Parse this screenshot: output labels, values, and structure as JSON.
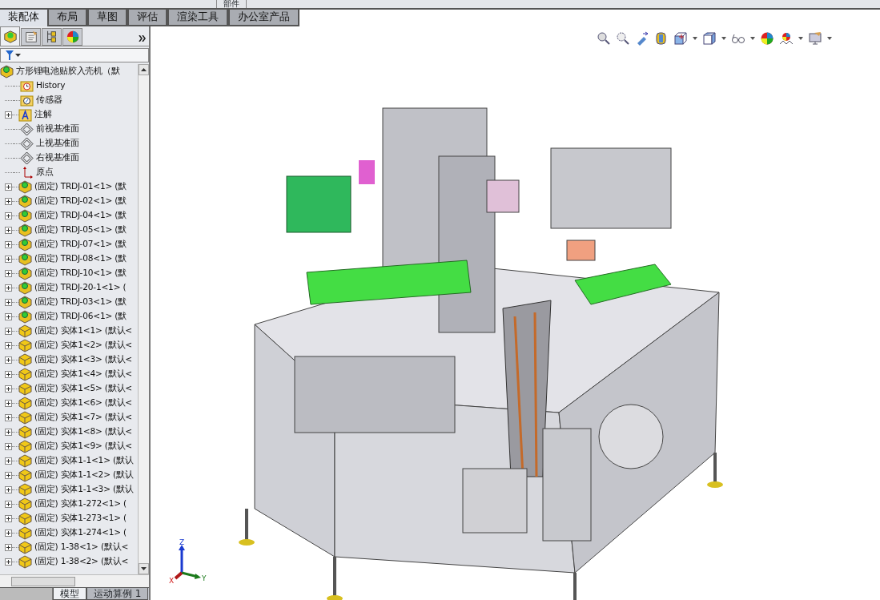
{
  "top_toolbar": {
    "label": "部件"
  },
  "command_tabs": [
    {
      "label": "装配体",
      "selected": true
    },
    {
      "label": "布局",
      "selected": false
    },
    {
      "label": "草图",
      "selected": false
    },
    {
      "label": "评估",
      "selected": false
    },
    {
      "label": "渲染工具",
      "selected": false
    },
    {
      "label": "办公室产品",
      "selected": false
    }
  ],
  "panel_tabs": [
    {
      "kind": "feature-tree",
      "selected": true
    },
    {
      "kind": "property",
      "selected": false
    },
    {
      "kind": "config",
      "selected": false
    },
    {
      "kind": "appearance",
      "selected": false
    }
  ],
  "tree": [
    {
      "kind": "assembly",
      "label": "方形锂电池贴胶入壳机（默",
      "children": [
        {
          "kind": "history",
          "label": "History",
          "expandable": false
        },
        {
          "kind": "sensor",
          "label": "传感器",
          "expandable": false
        },
        {
          "kind": "annotation",
          "label": "注解",
          "expandable": true
        },
        {
          "kind": "plane",
          "label": "前视基准面",
          "expandable": false
        },
        {
          "kind": "plane",
          "label": "上视基准面",
          "expandable": false
        },
        {
          "kind": "plane",
          "label": "右视基准面",
          "expandable": false
        },
        {
          "kind": "origin",
          "label": "原点",
          "expandable": false
        },
        {
          "kind": "subassembly",
          "label": "(固定) TRDJ-01<1> (默",
          "expandable": true
        },
        {
          "kind": "subassembly",
          "label": "(固定) TRDJ-02<1> (默",
          "expandable": true
        },
        {
          "kind": "subassembly",
          "label": "(固定) TRDJ-04<1> (默",
          "expandable": true
        },
        {
          "kind": "subassembly",
          "label": "(固定) TRDJ-05<1> (默",
          "expandable": true
        },
        {
          "kind": "subassembly",
          "label": "(固定) TRDJ-07<1> (默",
          "expandable": true
        },
        {
          "kind": "subassembly",
          "label": "(固定) TRDJ-08<1> (默",
          "expandable": true
        },
        {
          "kind": "subassembly",
          "label": "(固定) TRDJ-10<1> (默",
          "expandable": true
        },
        {
          "kind": "subassembly",
          "label": "(固定) TRDJ-20-1<1> (",
          "expandable": true
        },
        {
          "kind": "subassembly",
          "label": "(固定) TRDJ-03<1> (默",
          "expandable": true
        },
        {
          "kind": "subassembly",
          "label": "(固定) TRDJ-06<1> (默",
          "expandable": true
        },
        {
          "kind": "part",
          "label": "(固定) 实体1<1> (默认<",
          "expandable": true
        },
        {
          "kind": "part",
          "label": "(固定) 实体1<2> (默认<",
          "expandable": true
        },
        {
          "kind": "part",
          "label": "(固定) 实体1<3> (默认<",
          "expandable": true
        },
        {
          "kind": "part",
          "label": "(固定) 实体1<4> (默认<",
          "expandable": true
        },
        {
          "kind": "part",
          "label": "(固定) 实体1<5> (默认<",
          "expandable": true
        },
        {
          "kind": "part",
          "label": "(固定) 实体1<6> (默认<",
          "expandable": true
        },
        {
          "kind": "part",
          "label": "(固定) 实体1<7> (默认<",
          "expandable": true
        },
        {
          "kind": "part",
          "label": "(固定) 实体1<8> (默认<",
          "expandable": true
        },
        {
          "kind": "part",
          "label": "(固定) 实体1<9> (默认<",
          "expandable": true
        },
        {
          "kind": "part",
          "label": "(固定) 实体1-1<1> (默认",
          "expandable": true
        },
        {
          "kind": "part",
          "label": "(固定) 实体1-1<2> (默认",
          "expandable": true
        },
        {
          "kind": "part",
          "label": "(固定) 实体1-1<3> (默认",
          "expandable": true
        },
        {
          "kind": "part",
          "label": "(固定) 实体1-272<1> (",
          "expandable": true
        },
        {
          "kind": "part",
          "label": "(固定) 实体1-273<1> (",
          "expandable": true
        },
        {
          "kind": "part",
          "label": "(固定) 实体1-274<1> (",
          "expandable": true
        },
        {
          "kind": "part",
          "label": "(固定) 1-38<1> (默认<",
          "expandable": true
        },
        {
          "kind": "part",
          "label": "(固定) 1-38<2> (默认<",
          "expandable": true
        }
      ]
    }
  ],
  "bottom_tabs": [
    {
      "label": "模型",
      "selected": true
    },
    {
      "label": "运动算例 1",
      "selected": false
    }
  ],
  "triad": {
    "x": "X",
    "y": "Y",
    "z": "Z"
  }
}
